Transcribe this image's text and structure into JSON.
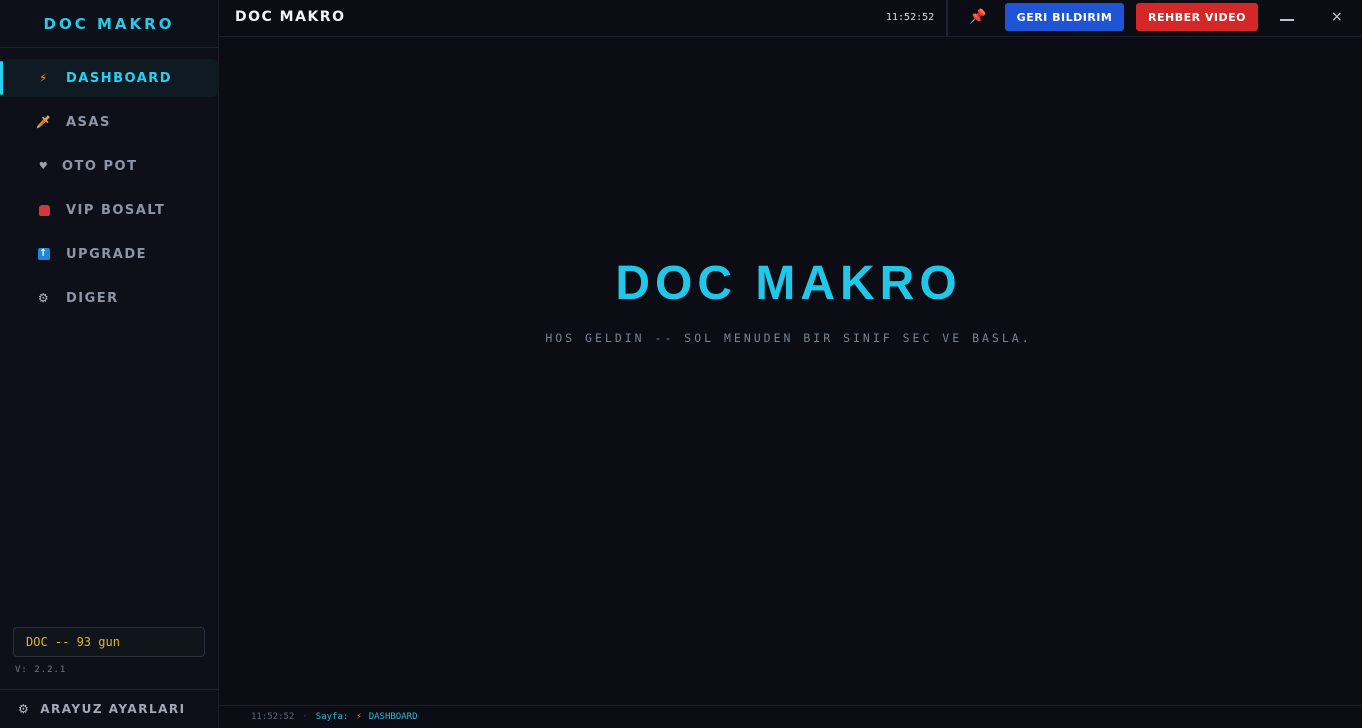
{
  "sidebar": {
    "brand": "DOC MAKRO",
    "items": [
      {
        "label": "DASHBOARD",
        "icon": "lightning-icon",
        "active": true
      },
      {
        "label": "ASAS",
        "icon": "sword-icon",
        "active": false
      },
      {
        "label": "OTO POT",
        "icon": "heart-icon",
        "active": false
      },
      {
        "label": "VIP BOSALT",
        "icon": "bag-icon",
        "active": false
      },
      {
        "label": "UPGRADE",
        "icon": "up-arrow-icon",
        "active": false
      },
      {
        "label": "DIGER",
        "icon": "gear-icon",
        "active": false
      }
    ],
    "license": "DOC -- 93 gun",
    "version": "V: 2.2.1",
    "settings_label": "ARAYUZ AYARLARI"
  },
  "topbar": {
    "title": "DOC MAKRO",
    "clock": "11:52:52",
    "feedback_label": "GERI BILDIRIM",
    "guide_label": "REHBER VIDEO",
    "close_glyph": "×"
  },
  "main": {
    "hero_title": "DOC MAKRO",
    "hero_subtitle": "HOS GELDIN -- SOL MENUDEN BIR SINIF SEC VE BASLA."
  },
  "statusbar": {
    "time": "11:52:52",
    "separator": "·",
    "page_label": "Sayfa:",
    "page_value": "DASHBOARD"
  },
  "colors": {
    "accent": "#22c6e6",
    "feedback_button": "#1f55d4",
    "guide_button": "#d42828",
    "license_text": "#e0b52e",
    "background": "#0b0c14"
  }
}
